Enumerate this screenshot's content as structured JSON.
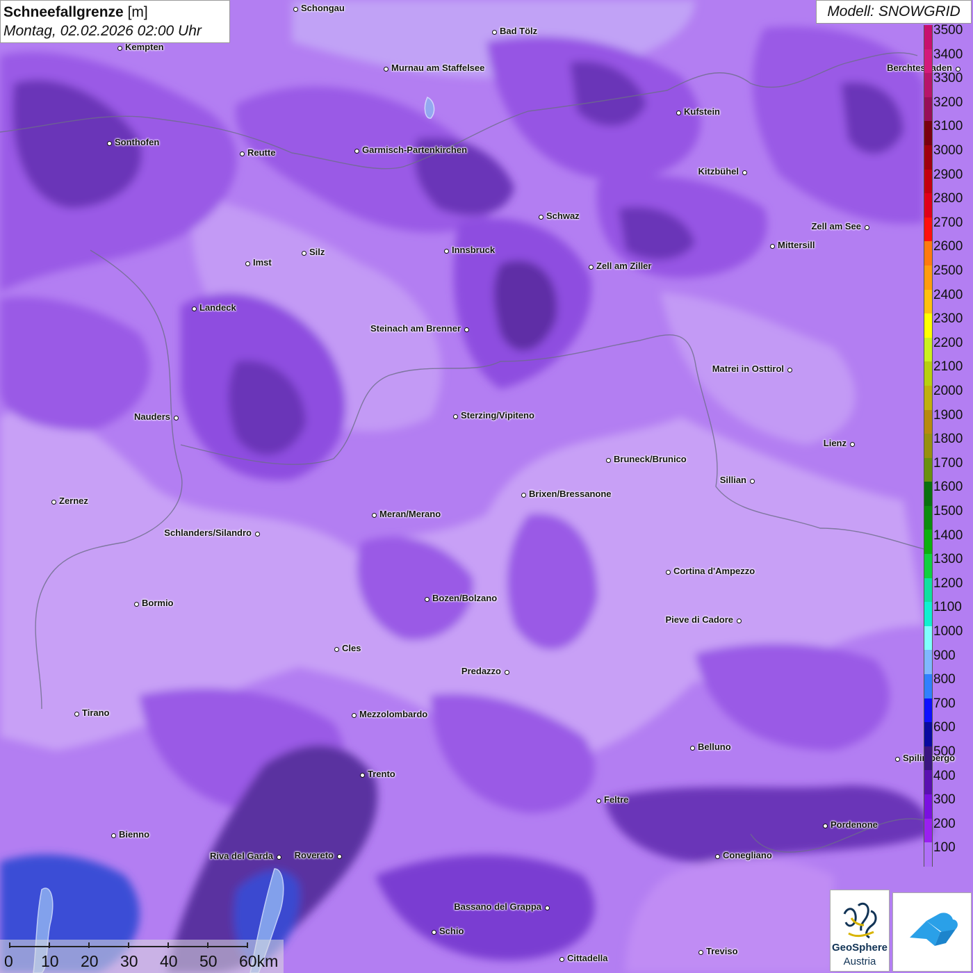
{
  "header": {
    "title_bold": "Schneefallgrenze",
    "title_unit": "[m]",
    "datetime": "Montag, 02.02.2026 02:00 Uhr",
    "model": "Modell: SNOWGRID"
  },
  "legend": {
    "levels": [
      {
        "label": "3500",
        "color": "#c8106e"
      },
      {
        "label": "3400",
        "color": "#d41a7a"
      },
      {
        "label": "3300",
        "color": "#b8146a"
      },
      {
        "label": "3200",
        "color": "#980e58"
      },
      {
        "label": "3100",
        "color": "#7a0010"
      },
      {
        "label": "3000",
        "color": "#a00010"
      },
      {
        "label": "2900",
        "color": "#c40010"
      },
      {
        "label": "2800",
        "color": "#e0001a"
      },
      {
        "label": "2700",
        "color": "#ff1010"
      },
      {
        "label": "2600",
        "color": "#ff7a10"
      },
      {
        "label": "2500",
        "color": "#ff9c10"
      },
      {
        "label": "2400",
        "color": "#ffc010"
      },
      {
        "label": "2300",
        "color": "#ffff00"
      },
      {
        "label": "2200",
        "color": "#ccf020"
      },
      {
        "label": "2100",
        "color": "#b8d010"
      },
      {
        "label": "2000",
        "color": "#c0b010"
      },
      {
        "label": "1900",
        "color": "#b88a10"
      },
      {
        "label": "1800",
        "color": "#989010"
      },
      {
        "label": "1700",
        "color": "#6a9010"
      },
      {
        "label": "1600",
        "color": "#0a7010"
      },
      {
        "label": "1500",
        "color": "#0c8c10"
      },
      {
        "label": "1400",
        "color": "#0cb010"
      },
      {
        "label": "1300",
        "color": "#10d040"
      },
      {
        "label": "1200",
        "color": "#10e0a0"
      },
      {
        "label": "1100",
        "color": "#10f0d0"
      },
      {
        "label": "1000",
        "color": "#80ffff"
      },
      {
        "label": "900",
        "color": "#80b8ff"
      },
      {
        "label": "800",
        "color": "#3080ff"
      },
      {
        "label": "700",
        "color": "#1010ff"
      },
      {
        "label": "600",
        "color": "#0a0aa0"
      },
      {
        "label": "500",
        "color": "#3a1480"
      },
      {
        "label": "400",
        "color": "#5a10b0"
      },
      {
        "label": "300",
        "color": "#7a10e0"
      },
      {
        "label": "200",
        "color": "#9a20f0"
      },
      {
        "label": "100",
        "color": "#b070f8"
      }
    ]
  },
  "cities": [
    {
      "name": "Schongau",
      "label_side": "right"
    },
    {
      "name": "Bad Tölz",
      "label_side": "right"
    },
    {
      "name": "Kempten",
      "label_side": "right"
    },
    {
      "name": "Murnau am Staffelsee",
      "label_side": "right"
    },
    {
      "name": "Berchtesgaden",
      "label_side": "left"
    },
    {
      "name": "Kufstein",
      "label_side": "right"
    },
    {
      "name": "Sonthofen",
      "label_side": "right"
    },
    {
      "name": "Reutte",
      "label_side": "right"
    },
    {
      "name": "Garmisch-Partenkirchen",
      "label_side": "right"
    },
    {
      "name": "Kitzbühel",
      "label_side": "left"
    },
    {
      "name": "Schwaz",
      "label_side": "right"
    },
    {
      "name": "Zell am See",
      "label_side": "left"
    },
    {
      "name": "Innsbruck",
      "label_side": "right"
    },
    {
      "name": "Mittersill",
      "label_side": "right"
    },
    {
      "name": "Imst",
      "label_side": "right"
    },
    {
      "name": "Silz",
      "label_side": "right"
    },
    {
      "name": "Zell am Ziller",
      "label_side": "right"
    },
    {
      "name": "Landeck",
      "label_side": "right"
    },
    {
      "name": "Steinach am Brenner",
      "label_side": "left"
    },
    {
      "name": "Matrei in Osttirol",
      "label_side": "left"
    },
    {
      "name": "Nauders",
      "label_side": "left"
    },
    {
      "name": "Sterzing/Vipiteno",
      "label_side": "right"
    },
    {
      "name": "Lienz",
      "label_side": "left"
    },
    {
      "name": "Bruneck/Brunico",
      "label_side": "right"
    },
    {
      "name": "Sillian",
      "label_side": "left"
    },
    {
      "name": "Brixen/Bressanone",
      "label_side": "right"
    },
    {
      "name": "Zernez",
      "label_side": "right"
    },
    {
      "name": "Meran/Merano",
      "label_side": "right"
    },
    {
      "name": "Schlanders/Silandro",
      "label_side": "left"
    },
    {
      "name": "Cortina d'Ampezzo",
      "label_side": "right"
    },
    {
      "name": "Bormio",
      "label_side": "right"
    },
    {
      "name": "Bozen/Bolzano",
      "label_side": "right"
    },
    {
      "name": "Pieve di Cadore",
      "label_side": "left"
    },
    {
      "name": "Cles",
      "label_side": "right"
    },
    {
      "name": "Predazzo",
      "label_side": "left"
    },
    {
      "name": "Tirano",
      "label_side": "right"
    },
    {
      "name": "Mezzolombardo",
      "label_side": "right"
    },
    {
      "name": "Belluno",
      "label_side": "right"
    },
    {
      "name": "Spilimbergo",
      "label_side": "right"
    },
    {
      "name": "Trento",
      "label_side": "right"
    },
    {
      "name": "Feltre",
      "label_side": "right"
    },
    {
      "name": "Pordenone",
      "label_side": "right"
    },
    {
      "name": "Bienno",
      "label_side": "right"
    },
    {
      "name": "Riva del Garda",
      "label_side": "left"
    },
    {
      "name": "Rovereto",
      "label_side": "left"
    },
    {
      "name": "Conegliano",
      "label_side": "right"
    },
    {
      "name": "Bassano del Grappa",
      "label_side": "left"
    },
    {
      "name": "Schio",
      "label_side": "right"
    },
    {
      "name": "Treviso",
      "label_side": "right"
    },
    {
      "name": "Cittadella",
      "label_side": "right"
    }
  ],
  "scalebar": {
    "labels": [
      "0",
      "10",
      "20",
      "30",
      "40",
      "50",
      "60km"
    ]
  },
  "logos": {
    "geosphere_name": "GeoSphere",
    "geosphere_sub": "Austria"
  }
}
